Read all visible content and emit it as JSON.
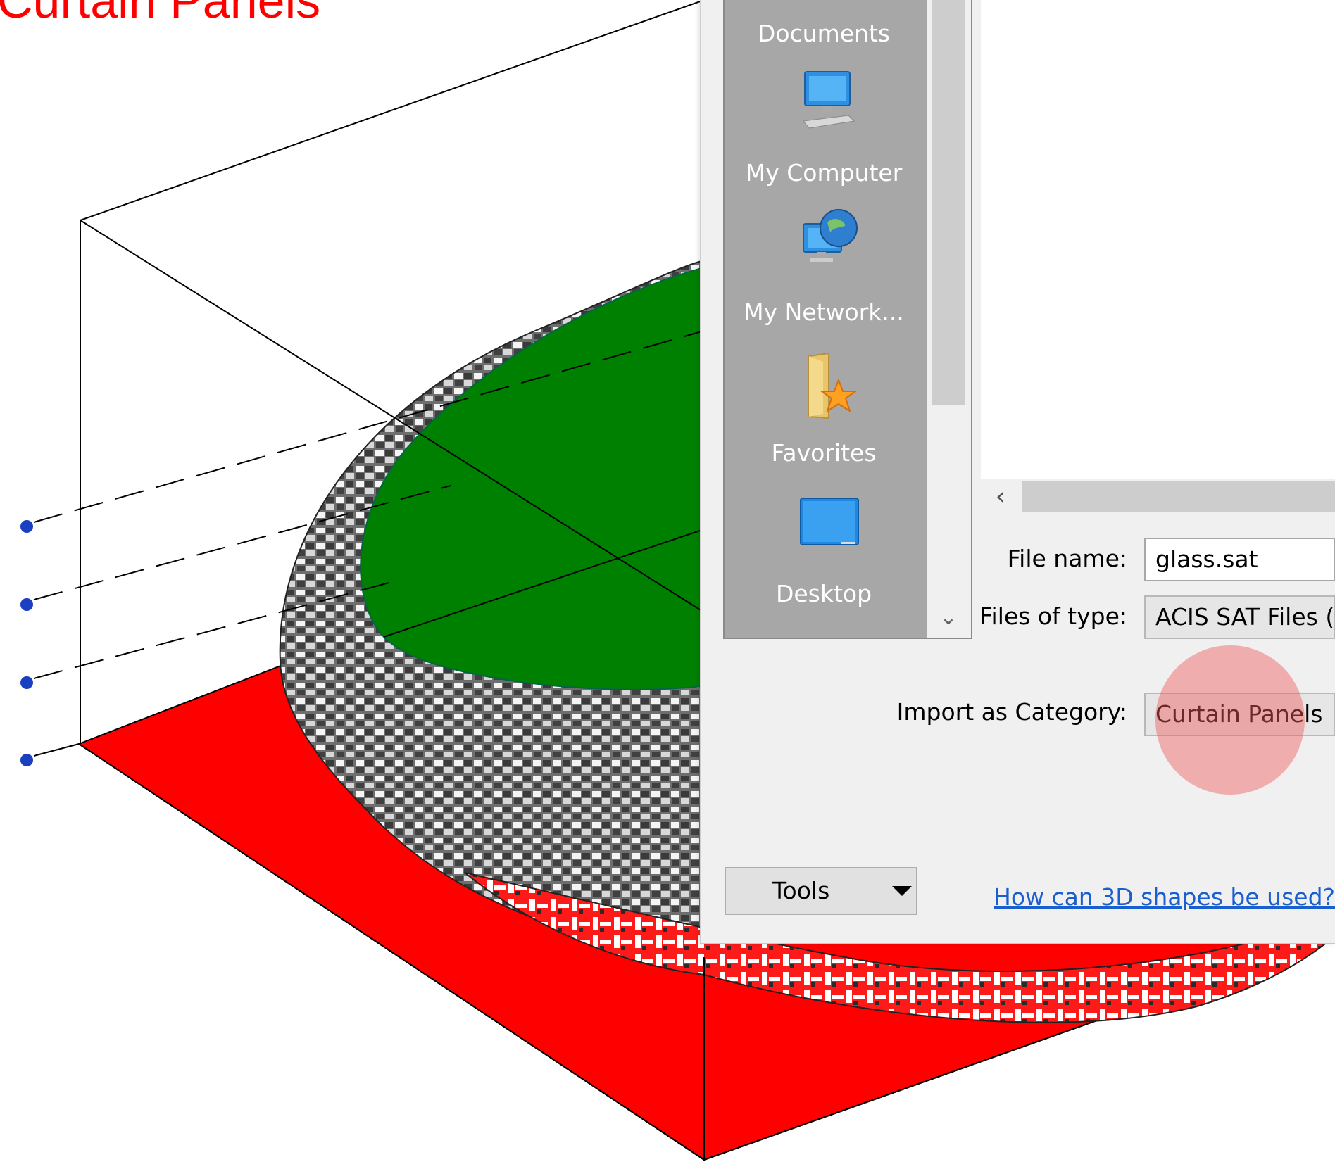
{
  "view": {
    "title": "Curtain Panels"
  },
  "dialog": {
    "places": [
      {
        "label": "Documents",
        "icon": "documents-icon"
      },
      {
        "label": "My Computer",
        "icon": "computer-icon"
      },
      {
        "label": "My Network...",
        "icon": "network-icon"
      },
      {
        "label": "Favorites",
        "icon": "favorites-icon"
      },
      {
        "label": "Desktop",
        "icon": "desktop-icon"
      }
    ],
    "file_name_label": "File name:",
    "file_name_value": "glass.sat",
    "files_of_type_label": "Files of type:",
    "files_of_type_value": "ACIS SAT Files (",
    "category_label": "Import as Category:",
    "category_value": "Curtain Panels",
    "tools_label": "Tools",
    "help_link": "How can 3D shapes be used?"
  },
  "colors": {
    "view_title": "#ff0000",
    "floor": "#ff0000",
    "roof": "#008000",
    "link": "#1a5fd0",
    "places_bar": "#a7a7a7"
  }
}
